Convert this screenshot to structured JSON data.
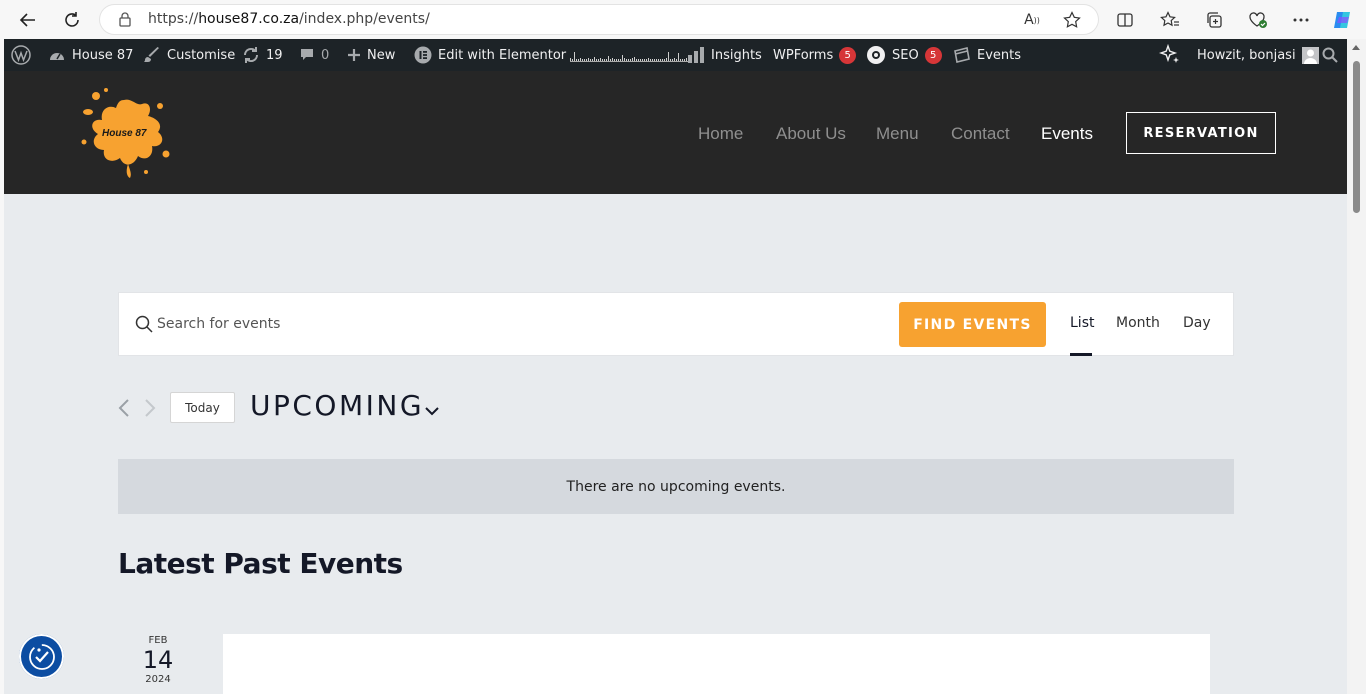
{
  "browser": {
    "url_prefix": "https://",
    "url_host": "house87.co.za",
    "url_path": "/index.php/events/"
  },
  "adminbar": {
    "site_name": "House 87",
    "customise": "Customise",
    "updates_count": "19",
    "comments_count": "0",
    "new_label": "New",
    "elementor_label": "Edit with Elementor",
    "insights_label": "Insights",
    "wpforms_label": "WPForms",
    "wpforms_badge": "5",
    "seo_label": "SEO",
    "seo_badge": "5",
    "events_label": "Events",
    "user_greeting": "Howzit, bonjasi"
  },
  "header": {
    "logo_text": "House 87",
    "nav": [
      "Home",
      "About Us",
      "Menu",
      "Contact",
      "Events"
    ],
    "active_nav": "Events",
    "reservation_label": "RESERVATION"
  },
  "events_bar": {
    "search_placeholder": "Search for events",
    "find_button": "FIND EVENTS",
    "views": [
      "List",
      "Month",
      "Day"
    ],
    "active_view": "List"
  },
  "date_nav": {
    "today_label": "Today",
    "period_label": "UPCOMING"
  },
  "notice": "There are no upcoming events.",
  "past": {
    "title": "Latest Past Events",
    "first_event": {
      "month": "FEB",
      "day": "14",
      "year": "2024"
    }
  },
  "colors": {
    "accent": "#f7a230",
    "adminbar": "#1d2327",
    "header": "#262626",
    "page_bg": "#e8ebee"
  }
}
